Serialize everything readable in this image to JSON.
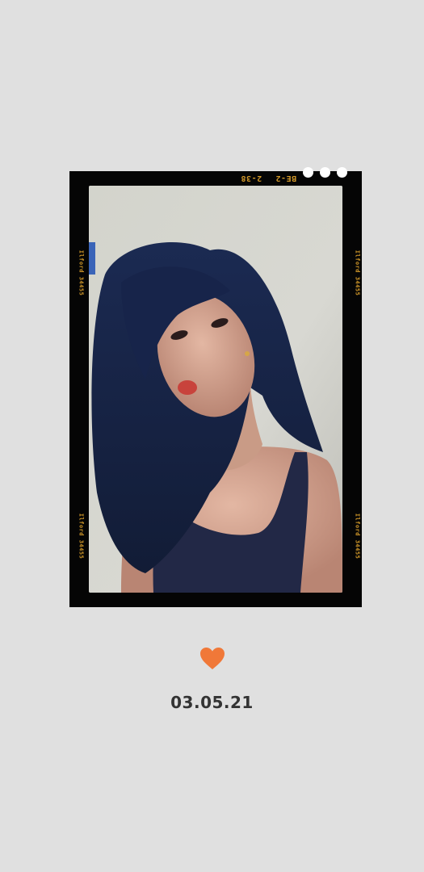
{
  "frame": {
    "top_codes": [
      "2-38",
      "BE-2"
    ],
    "side_code": "Ilford 34455"
  },
  "photo": {
    "description_icon": "portrait-photo"
  },
  "heart": {
    "icon": "heart-icon",
    "color": "#f07838"
  },
  "date": "03.05.21",
  "colors": {
    "background": "#e0e0e0",
    "frame": "#050505",
    "edge_text": "#d49a2a",
    "date_text": "#333333"
  }
}
